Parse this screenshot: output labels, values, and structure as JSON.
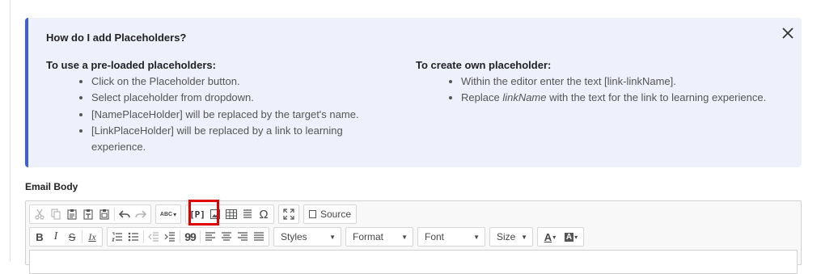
{
  "info": {
    "title": "How do I add Placeholders?",
    "left": {
      "heading": "To use a pre-loaded placeholders:",
      "items": [
        "Click on the Placeholder button.",
        "Select placeholder from dropdown.",
        "[NamePlaceHolder] will be replaced by the target's name.",
        "[LinkPlaceHolder] will be replaced by a link to learning experience."
      ]
    },
    "right": {
      "heading": "To create own placeholder:",
      "item1": "Within the editor enter the text [link-linkName].",
      "item2_pre": "Replace ",
      "item2_em": "linkName",
      "item2_post": " with the text for the link to learning experience."
    }
  },
  "email_body_label": "Email Body",
  "toolbar": {
    "source_label": "Source",
    "placeholder_label": "[P]",
    "spellcheck_label": "ABC",
    "styles_label": "Styles",
    "format_label": "Format",
    "font_label": "Font",
    "size_label": "Size",
    "bold_label": "B",
    "italic_label": "I",
    "strike_label": "S",
    "clear_label": "Ix",
    "blockquote_label": "99",
    "special_char_label": "Ω",
    "text_color_label": "A",
    "bg_color_label": "A",
    "highlight_color": "#e00000",
    "accent_color": "#3b5fe0"
  }
}
